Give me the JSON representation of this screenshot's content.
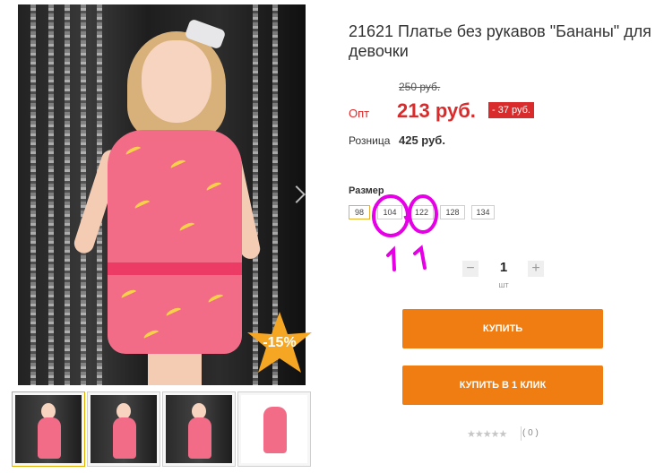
{
  "product": {
    "title": "21621 Платье без рукавов \"Бананы\" для девочки",
    "old_price": "250 руб.",
    "opt_label": "Опт",
    "opt_price": "213 руб.",
    "discount_badge": "- 37 руб.",
    "retail_label": "Розница",
    "retail_price": "425 руб."
  },
  "gallery": {
    "discount_star": "-15%",
    "thumbnails": [
      "thumbnail-1",
      "thumbnail-2",
      "thumbnail-3",
      "thumbnail-4"
    ]
  },
  "sizes": {
    "label": "Размер",
    "options": [
      "98",
      "104",
      "122",
      "128",
      "134"
    ],
    "selected": "98"
  },
  "quantity": {
    "minus": "−",
    "value": "1",
    "plus": "+",
    "unit": "шт"
  },
  "actions": {
    "buy": "КУПИТЬ",
    "buy_one_click": "КУПИТЬ В 1 КЛИК"
  },
  "rating": {
    "stars": "★★★★★",
    "count": "( 0 )"
  },
  "colors": {
    "accent_orange": "#f07d12",
    "price_red": "#d92b2b",
    "annotation_magenta": "#e600e6",
    "selected_size_border": "#e8b22a"
  }
}
